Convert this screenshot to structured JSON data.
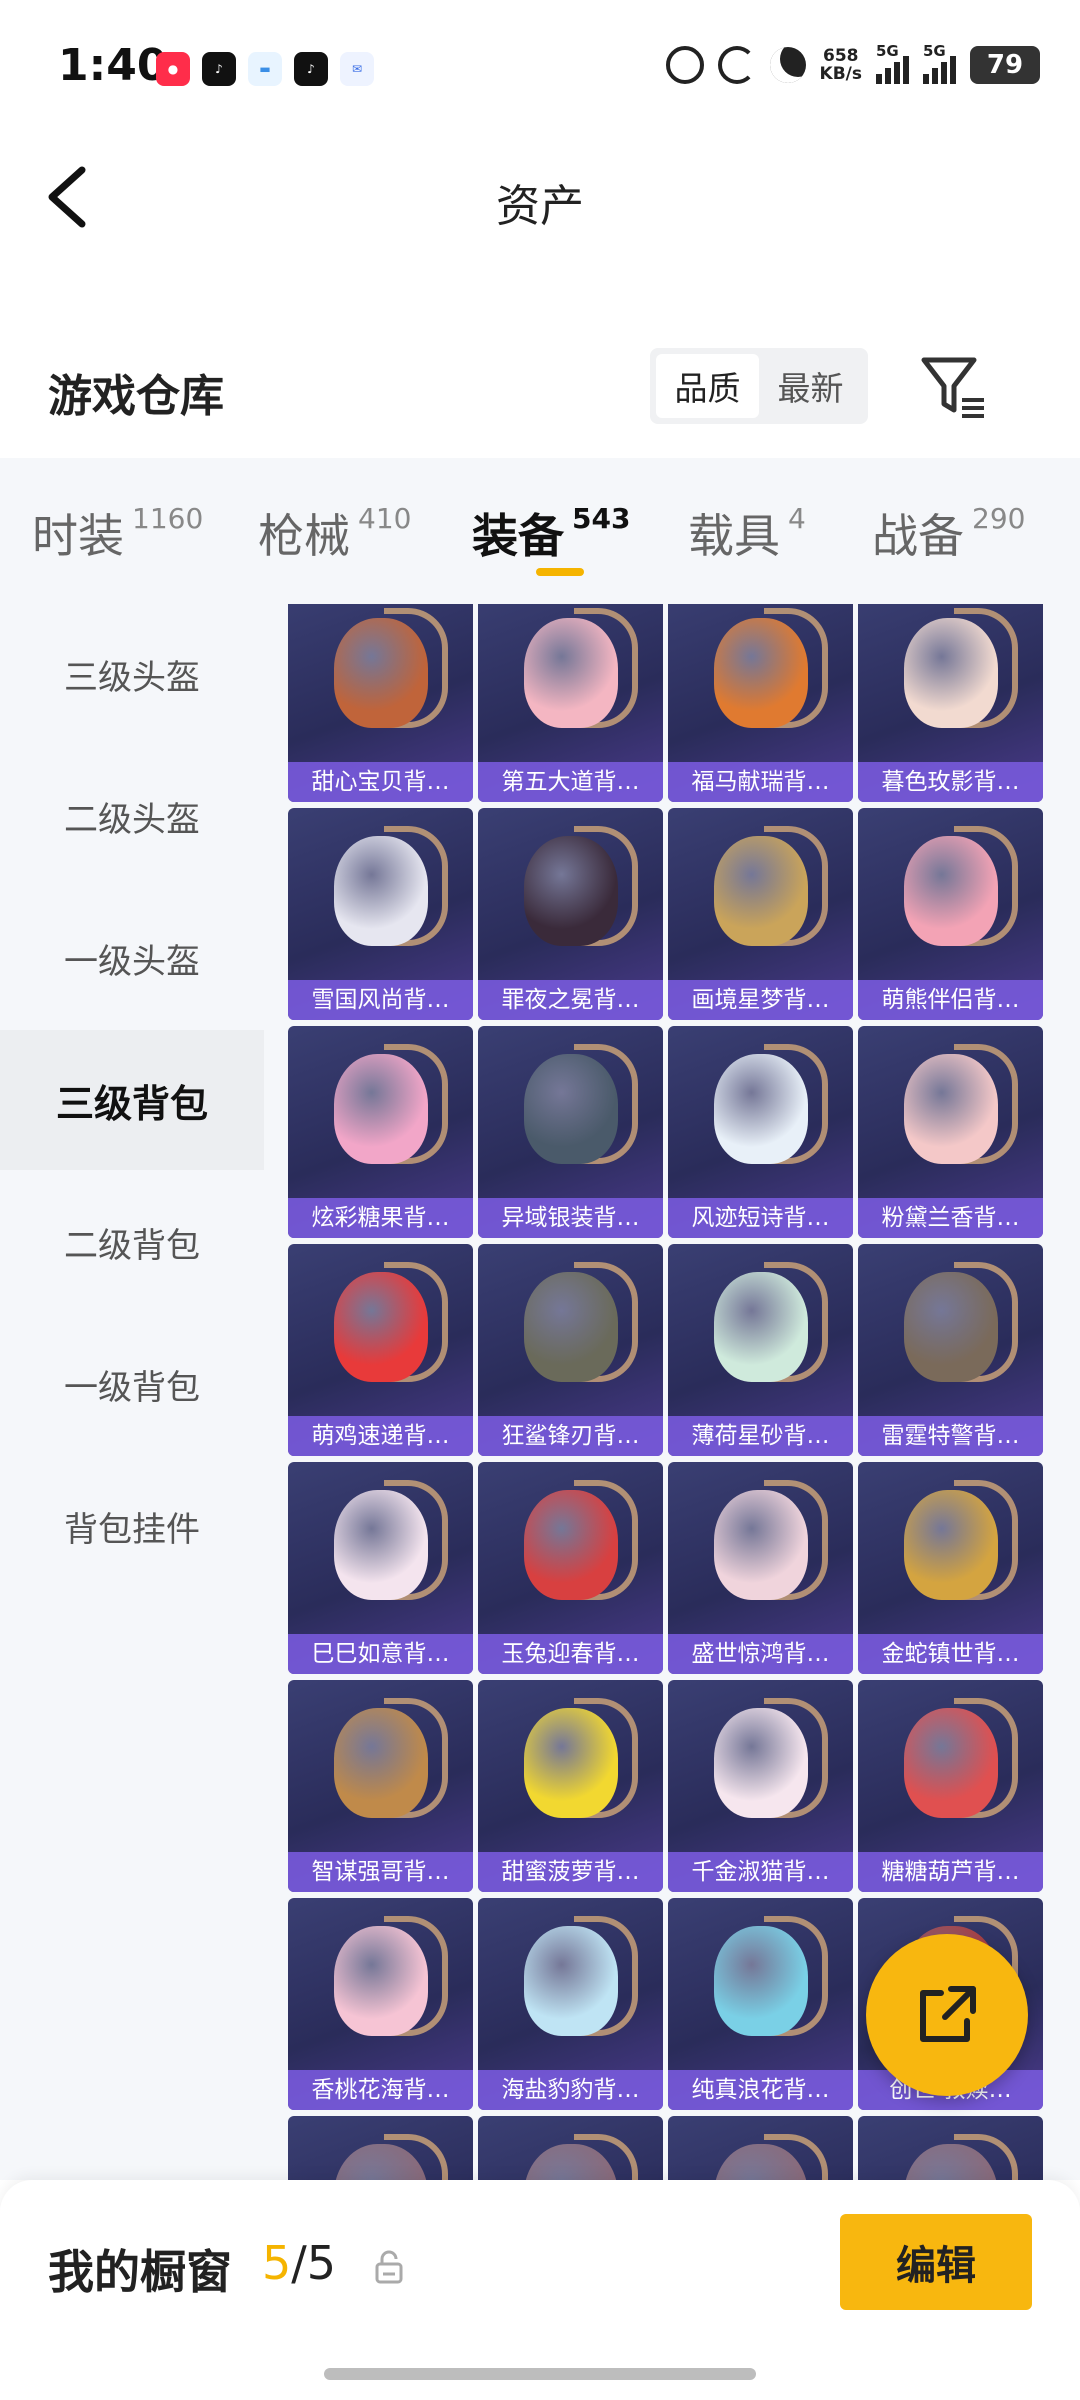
{
  "status_bar": {
    "time": "1:40",
    "net_speed": "658",
    "net_unit": "KB/s",
    "net_type_1": "5G",
    "net_type_2": "5G",
    "battery": "79",
    "app_icons": [
      "xiaohongshu-icon",
      "tiktok-icon",
      "wallet-icon",
      "tiktok-icon",
      "mail-icon"
    ]
  },
  "header": {
    "title": "资产",
    "back_icon": "chevron-left-icon"
  },
  "warehouse": {
    "title": "游戏仓库",
    "sort_options": [
      "品质",
      "最新"
    ],
    "active_sort": "品质",
    "filter_icon": "filter-icon"
  },
  "tabs": [
    {
      "label": "时装",
      "count": "1160"
    },
    {
      "label": "枪械",
      "count": "410"
    },
    {
      "label": "装备",
      "count": "543"
    },
    {
      "label": "载具",
      "count": "4"
    },
    {
      "label": "战备",
      "count": "290"
    }
  ],
  "active_tab": "装备",
  "sidebar": {
    "items": [
      "三级头盔",
      "二级头盔",
      "一级头盔",
      "三级背包",
      "二级背包",
      "一级背包",
      "背包挂件"
    ],
    "active": "三级背包"
  },
  "items": [
    "甜心宝贝背…",
    "第五大道背…",
    "福马献瑞背…",
    "暮色玫影背…",
    "雪国风尚背…",
    "罪夜之冕背…",
    "画境星梦背…",
    "萌熊伴侣背…",
    "炫彩糖果背…",
    "异域银装背…",
    "风迹短诗背…",
    "粉黛兰香背…",
    "萌鸡速递背…",
    "狂鲨锋刃背…",
    "薄荷星砂背…",
    "雷霆特警背…",
    "巳巳如意背…",
    "玉兔迎春背…",
    "盛世惊鸿背…",
    "金蛇镇世背…",
    "智谋强哥背…",
    "甜蜜菠萝背…",
    "千金淑猫背…",
    "糖糖葫芦背…",
    "香桃花海背…",
    "海盐豹豹背…",
    "纯真浪花背…",
    "创世·救赎…"
  ],
  "colors": {
    "accent": "#f8b70f",
    "card_bg": "#2d2f5e",
    "label_strip": "#7a5ae0",
    "art": [
      "#c0643a",
      "#f4b6c2",
      "#e07a30",
      "#f2dad0",
      "#e6e6f0",
      "#3a2a3a",
      "#caa45a",
      "#f3a3b5",
      "#f2a6c8",
      "#4a5a6a",
      "#e8f0f8",
      "#f4c8c8",
      "#e83a3a",
      "#6a6a5a",
      "#cfeadc",
      "#7a6a5a",
      "#f4e4ee",
      "#d84040",
      "#f0d4dc",
      "#d4a440",
      "#c08a4a",
      "#f2d830",
      "#f6e6ee",
      "#e05050",
      "#f6c4d4",
      "#bfe4f4",
      "#7ad0e6",
      "#b03a3a"
    ]
  },
  "fab_icon": "share-icon",
  "bottom": {
    "label": "我的橱窗",
    "count_current": "5",
    "count_sep": "/",
    "count_total": "5",
    "lock_icon": "lock-icon",
    "edit_label": "编辑"
  }
}
